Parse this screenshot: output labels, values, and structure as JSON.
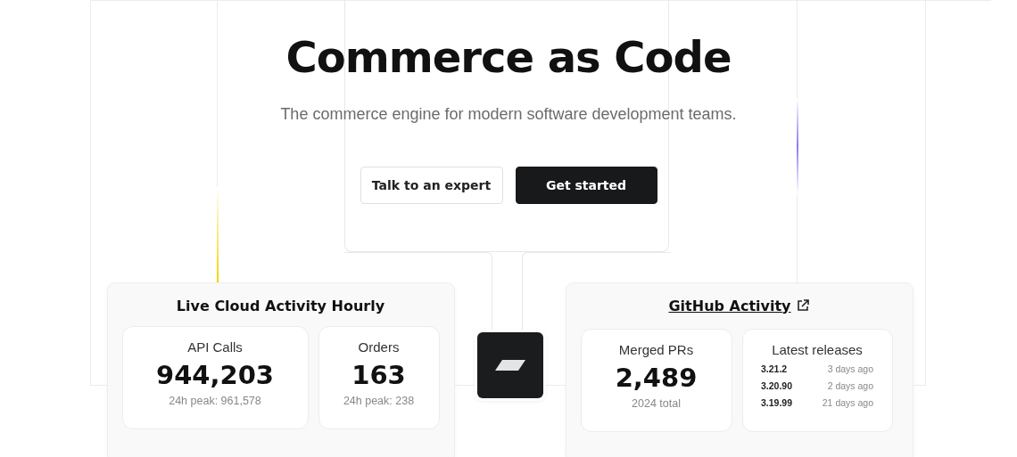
{
  "hero": {
    "title": "Commerce as Code",
    "subtitle": "The commerce engine for modern software development teams."
  },
  "buttons": [
    {
      "label": "Talk to an expert",
      "kind": "secondary"
    },
    {
      "label": "Get started",
      "kind": "primary"
    }
  ],
  "cloud_card": {
    "title": "Live Cloud Activity Hourly",
    "stats": [
      {
        "label": "API Calls",
        "value": "944,203",
        "note": "24h peak: 961,578"
      },
      {
        "label": "Orders",
        "value": "163",
        "note": "24h peak: 238"
      }
    ]
  },
  "github_card": {
    "title": "GitHub Activity",
    "merged": {
      "label": "Merged PRs",
      "value": "2,489",
      "note": "2024 total"
    },
    "releases": {
      "title": "Latest releases",
      "items": [
        {
          "version": "3.21.2",
          "age": "3 days ago"
        },
        {
          "version": "3.20.90",
          "age": "2 days ago"
        },
        {
          "version": "3.19.99",
          "age": "21 days ago"
        }
      ]
    }
  }
}
